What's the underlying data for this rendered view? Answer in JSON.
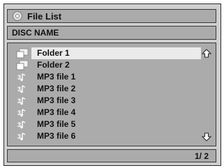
{
  "header": {
    "title": "File List",
    "icon": "disc-icon"
  },
  "disc": {
    "name": "DISC NAME"
  },
  "files": [
    {
      "label": "Folder 1",
      "icon": "folder-icon",
      "selected": true
    },
    {
      "label": "Folder 2",
      "icon": "folder-icon",
      "selected": false
    },
    {
      "label": "MP3 file 1",
      "icon": "mp3-icon",
      "selected": false
    },
    {
      "label": "MP3 file 2",
      "icon": "mp3-icon",
      "selected": false
    },
    {
      "label": "MP3 file 3",
      "icon": "mp3-icon",
      "selected": false
    },
    {
      "label": "MP3 file 4",
      "icon": "mp3-icon",
      "selected": false
    },
    {
      "label": "MP3 file 5",
      "icon": "mp3-icon",
      "selected": false
    },
    {
      "label": "MP3 file 6",
      "icon": "mp3-icon",
      "selected": false
    }
  ],
  "pager": {
    "text": "1/ 2"
  },
  "colors": {
    "panel": "#ababab",
    "highlight": "#ebebeb",
    "frame": "#cfcfcf"
  }
}
